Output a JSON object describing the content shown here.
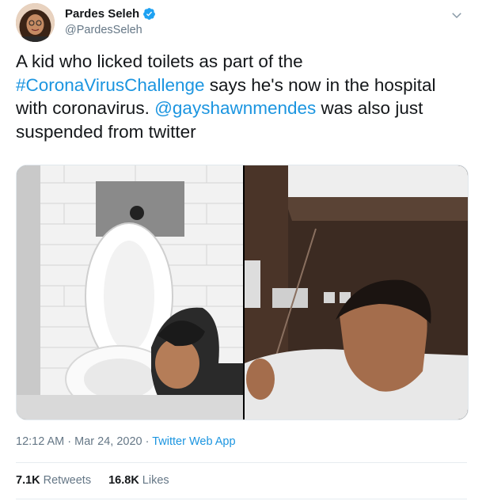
{
  "author": {
    "name": "Pardes Seleh",
    "handle": "@PardesSeleh",
    "avatar_icon": "profile-photo"
  },
  "tweet": {
    "text_1": "A kid who licked toilets as part of the",
    "hashtag": "#CoronaVirusChallenge",
    "text_2": " says he's now in the hospital",
    "text_3": "with coronavirus. ",
    "mention": "@gayshawnmendes",
    "text_4": " was also just",
    "text_5": "suspended from twitter"
  },
  "meta": {
    "time": "12:12 AM",
    "sep1": " · ",
    "date": "Mar 24, 2020",
    "sep2": " · ",
    "app": "Twitter Web App"
  },
  "stats": {
    "retweets_count": "7.1K",
    "retweets_label": "Retweets",
    "likes_count": "16.8K",
    "likes_label": "Likes"
  },
  "colors": {
    "link": "#1b95e0",
    "verified": "#1da1f2",
    "secondary": "#657786"
  }
}
